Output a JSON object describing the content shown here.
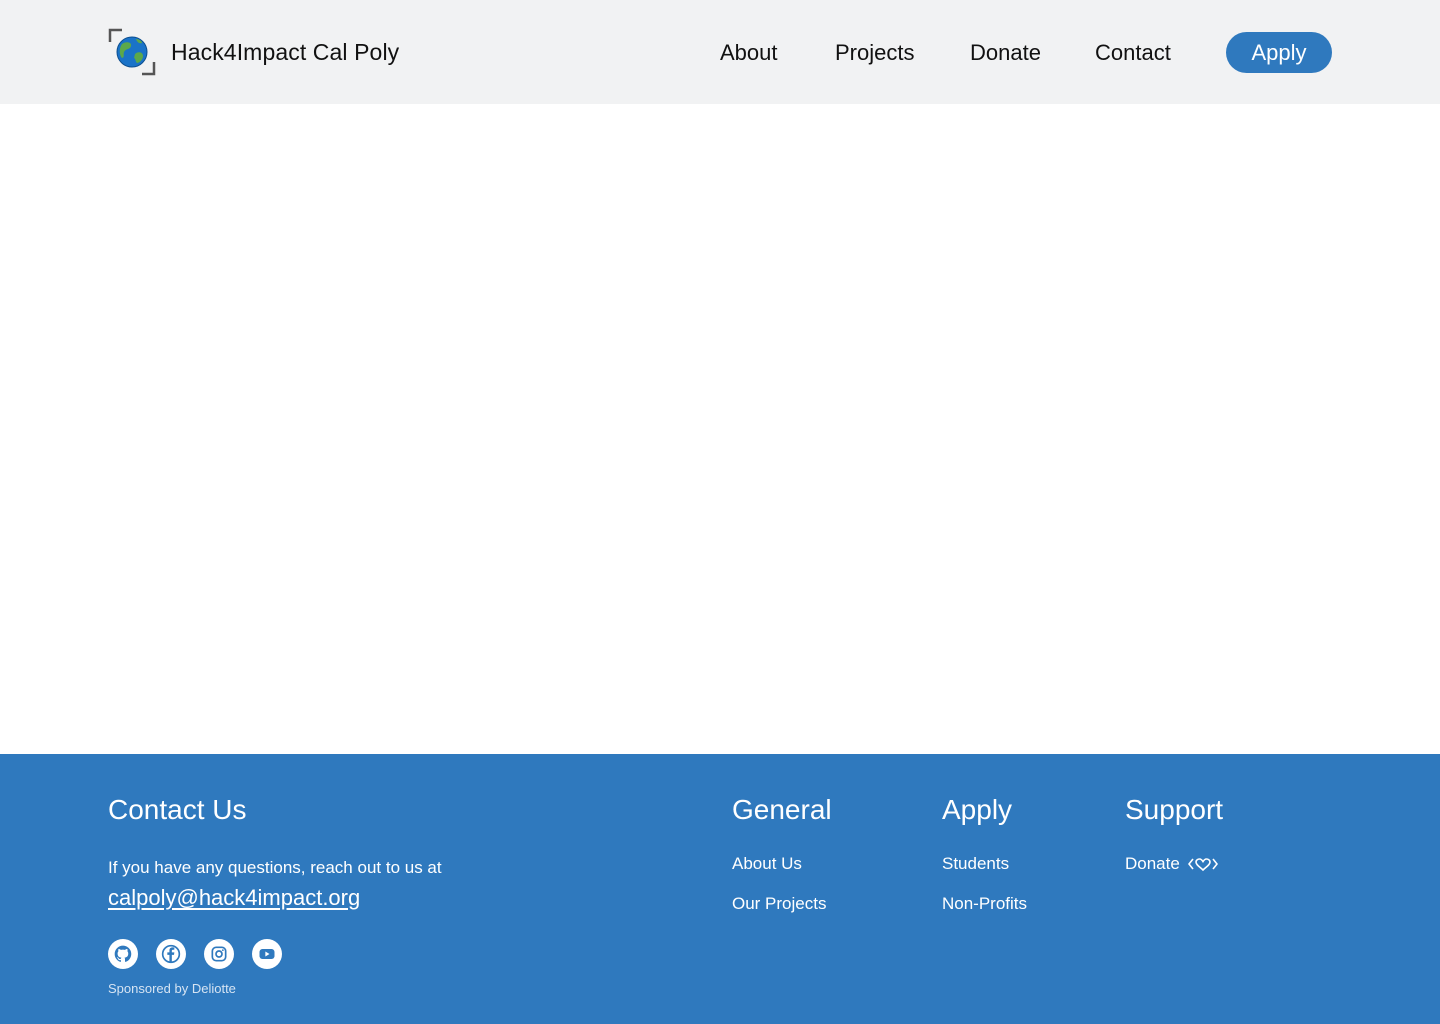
{
  "header": {
    "brand": "Hack4Impact Cal Poly",
    "logo_icon": "globe-icon",
    "nav": [
      "About",
      "Projects",
      "Donate",
      "Contact"
    ],
    "apply_label": "Apply"
  },
  "footer": {
    "contact": {
      "title": "Contact Us",
      "text": "If you have any questions, reach out to us at",
      "email": "calpoly@hack4impact.org"
    },
    "socials": [
      "github-icon",
      "facebook-icon",
      "instagram-icon",
      "youtube-icon"
    ],
    "sponsor": "Sponsored by Deliotte",
    "general": {
      "title": "General",
      "links": [
        "About Us",
        "Our Projects"
      ]
    },
    "apply": {
      "title": "Apply",
      "links": [
        "Students",
        "Non-Profits"
      ]
    },
    "support": {
      "title": "Support",
      "links": [
        "Donate"
      ],
      "donate_icon": "heart-code-icon"
    }
  },
  "colors": {
    "header_bg": "#f1f2f3",
    "primary": "#2f79be",
    "text": "#111111"
  }
}
